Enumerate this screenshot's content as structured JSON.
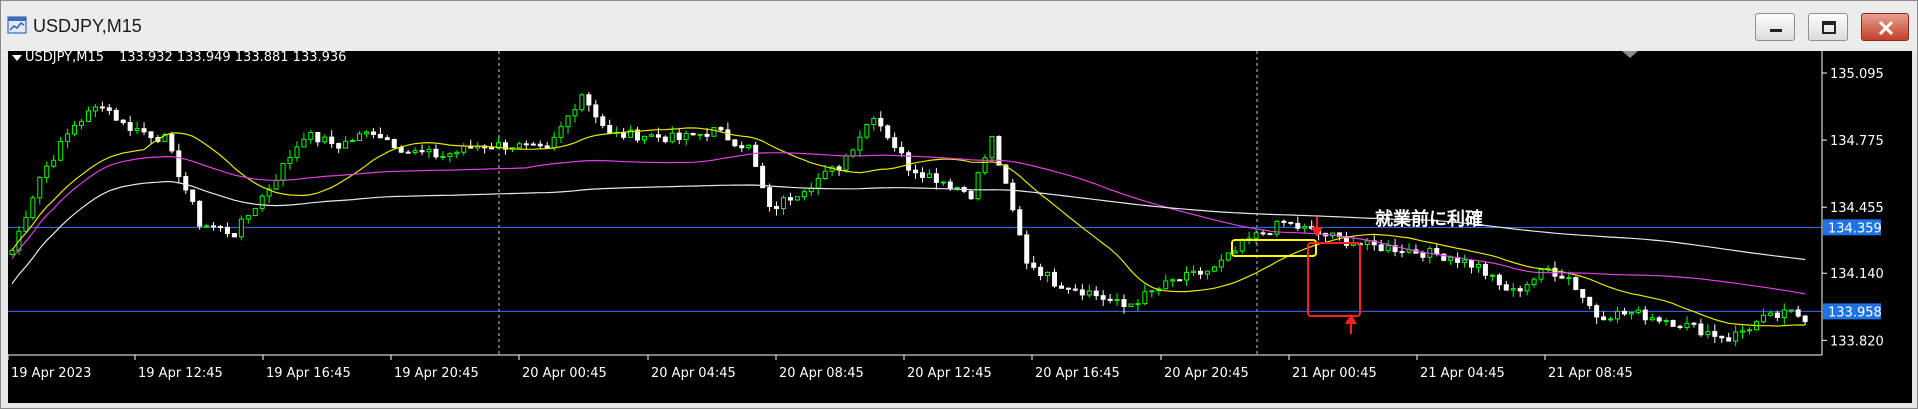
{
  "window": {
    "title": "USDJPY,M15",
    "buttons": [
      "minimize",
      "restore",
      "close"
    ],
    "icons": {
      "app": "chart-window-icon",
      "minimize": "minimize-icon",
      "restore": "restore-icon",
      "close": "close-icon"
    }
  },
  "header": {
    "symbol": "USDJPY,M15",
    "ohlc": "133.932 133.949 133.881 133.936"
  },
  "annotation": {
    "text": "就業前に利確"
  },
  "colors": {
    "background": "#000000",
    "grid": "#c8c8c8",
    "axis": "#ffffff",
    "bull": "#00ff00",
    "bear": "#ffffff",
    "ma_fast": "#e6e600",
    "ma_mid": "#e040e0",
    "ma_slow": "#e8e8e8",
    "hline": "#3a6cff",
    "price_tag": "#1e73e6",
    "highlight_box": "#ffff00",
    "red_box": "#ff2020"
  },
  "chart_data": {
    "type": "candlestick",
    "symbol": "USDJPY",
    "timeframe": "M15",
    "ylim": [
      133.75,
      135.2
    ],
    "y_ticks": [
      "135.095",
      "134.775",
      "134.455",
      "134.140",
      "133.820"
    ],
    "y_tick_values": [
      135.095,
      134.775,
      134.455,
      134.14,
      133.82
    ],
    "x_tick_labels": [
      "19 Apr 2023",
      "19 Apr 12:45",
      "19 Apr 16:45",
      "19 Apr 20:45",
      "20 Apr 00:45",
      "20 Apr 04:45",
      "20 Apr 08:45",
      "20 Apr 12:45",
      "20 Apr 16:45",
      "20 Apr 20:45",
      "21 Apr 00:45",
      "21 Apr 04:45",
      "21 Apr 08:45"
    ],
    "period_separators": [
      "20 Apr 00:00",
      "21 Apr 00:00"
    ],
    "horizontal_lines": [
      {
        "price": 134.359,
        "label": "134.359"
      },
      {
        "price": 133.958,
        "label": "133.958"
      }
    ],
    "series": [
      {
        "kind": "candles",
        "anchors": [
          [
            0,
            134.25
          ],
          [
            4,
            134.6
          ],
          [
            9,
            134.85
          ],
          [
            13,
            134.95
          ],
          [
            16,
            134.85
          ],
          [
            22,
            134.78
          ],
          [
            27,
            134.38
          ],
          [
            32,
            134.33
          ],
          [
            37,
            134.55
          ],
          [
            42,
            134.8
          ],
          [
            47,
            134.75
          ],
          [
            52,
            134.82
          ],
          [
            57,
            134.72
          ],
          [
            62,
            134.7
          ],
          [
            67,
            134.75
          ],
          [
            72,
            134.75
          ],
          [
            77,
            134.72
          ],
          [
            82,
            135.0
          ],
          [
            86,
            134.8
          ],
          [
            91,
            134.8
          ],
          [
            96,
            134.78
          ],
          [
            101,
            134.82
          ],
          [
            106,
            134.74
          ],
          [
            109,
            134.44
          ],
          [
            114,
            134.55
          ],
          [
            119,
            134.65
          ],
          [
            124,
            134.9
          ],
          [
            129,
            134.65
          ],
          [
            134,
            134.58
          ],
          [
            138,
            134.52
          ],
          [
            141,
            134.78
          ],
          [
            146,
            134.2
          ],
          [
            150,
            134.1
          ],
          [
            155,
            134.05
          ],
          [
            160,
            133.98
          ],
          [
            167,
            134.1
          ],
          [
            173,
            134.16
          ],
          [
            178,
            134.3
          ],
          [
            183,
            134.38
          ],
          [
            188,
            134.33
          ],
          [
            195,
            134.27
          ],
          [
            199,
            134.26
          ],
          [
            203,
            134.24
          ],
          [
            207,
            134.22
          ],
          [
            211,
            134.17
          ],
          [
            214,
            134.08
          ],
          [
            216,
            134.05
          ],
          [
            221,
            134.16
          ],
          [
            224,
            134.12
          ],
          [
            228,
            133.94
          ],
          [
            233,
            133.95
          ],
          [
            238,
            133.92
          ],
          [
            242,
            133.88
          ],
          [
            247,
            133.83
          ],
          [
            252,
            133.92
          ],
          [
            256,
            133.95
          ],
          [
            258,
            133.93
          ]
        ]
      },
      {
        "kind": "ma",
        "name": "",
        "period": 20,
        "color": "#e6e600"
      },
      {
        "kind": "ma",
        "name": "",
        "period": 75,
        "color": "#e040e0"
      },
      {
        "kind": "ma",
        "name": "",
        "period": 200,
        "color": "#e8e8e8"
      }
    ],
    "candle_count": 259
  }
}
